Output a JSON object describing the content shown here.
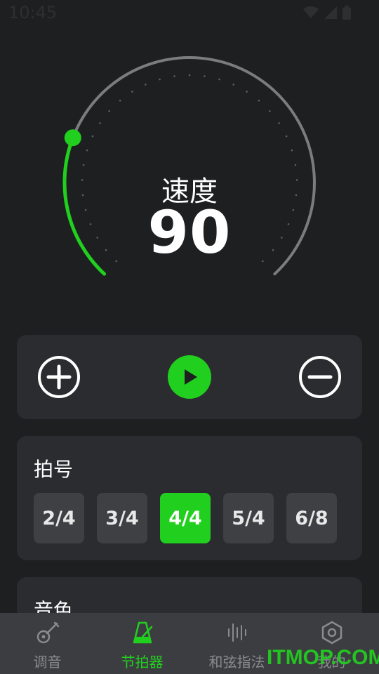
{
  "status_bar": {
    "time": "10:45"
  },
  "tempo": {
    "label": "速度",
    "value": "90"
  },
  "time_signature": {
    "title": "拍号",
    "options": [
      "2/4",
      "3/4",
      "4/4",
      "5/4",
      "6/8"
    ],
    "selected": "4/4"
  },
  "tone": {
    "title": "音色"
  },
  "tabs": [
    {
      "label": "调音",
      "icon": "guitar-icon",
      "active": false
    },
    {
      "label": "节拍器",
      "icon": "metronome-icon",
      "active": true
    },
    {
      "label": "和弦指法",
      "icon": "waveform-icon",
      "active": false
    },
    {
      "label": "我的",
      "icon": "hexagon-settings-icon",
      "active": false
    }
  ],
  "watermark": "ITMOP.COM",
  "colors": {
    "accent": "#21cf1f",
    "background": "#1e1f21",
    "card": "#2b2c2f",
    "tabbar": "#3c3d40"
  }
}
